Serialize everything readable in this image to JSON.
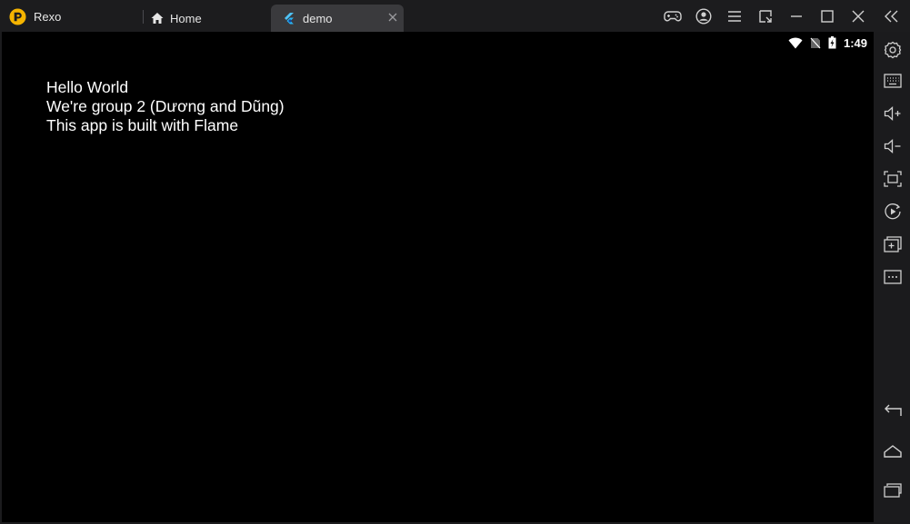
{
  "app": {
    "name": "Rexo",
    "brand_color": "#f5b400"
  },
  "tabs": [
    {
      "label": "Home",
      "icon": "home-icon"
    },
    {
      "label": "demo",
      "icon": "flutter-icon",
      "active": true
    }
  ],
  "window_controls": [
    "gamepad-icon",
    "account-icon",
    "menu-icon",
    "resize-icon",
    "minimize-icon",
    "maximize-icon",
    "close-icon",
    "collapse-sidebar-icon"
  ],
  "status_bar": {
    "time": "1:49",
    "icons": [
      "wifi-icon",
      "no-sim-icon",
      "battery-charging-icon"
    ]
  },
  "app_content": {
    "line1": "Hello World",
    "line2": "We're group 2 (Dương and Dũng)",
    "line3": "This app is built with Flame"
  },
  "sidebar": {
    "top_tools": [
      "settings-icon",
      "keyboard-icon",
      "volume-up-icon",
      "volume-down-icon",
      "screenshot-icon",
      "screen-record-icon",
      "multi-instance-icon",
      "more-icon"
    ],
    "nav": [
      "back-icon",
      "home-icon",
      "recent-apps-icon"
    ]
  },
  "colors": {
    "background": "#1b1b1d",
    "active_tab": "#3a3a3d",
    "screen": "#000000",
    "text": "#ffffff"
  }
}
